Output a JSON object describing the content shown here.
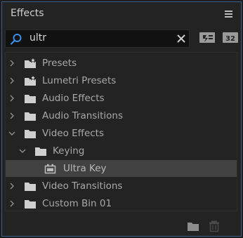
{
  "panel": {
    "title": "Effects"
  },
  "search": {
    "value": "ultr"
  },
  "tree": {
    "items": [
      {
        "label": "Presets",
        "expanded": false,
        "icon": "preset-folder-icon"
      },
      {
        "label": "Lumetri Presets",
        "expanded": false,
        "icon": "preset-folder-icon"
      },
      {
        "label": "Audio Effects",
        "expanded": false,
        "icon": "folder-icon"
      },
      {
        "label": "Audio Transitions",
        "expanded": false,
        "icon": "folder-icon"
      },
      {
        "label": "Video Effects",
        "expanded": true,
        "icon": "folder-icon"
      },
      {
        "label": "Keying",
        "expanded": true,
        "icon": "folder-icon"
      },
      {
        "label": "Ultra Key",
        "selected": true,
        "icon": "effect-icon"
      },
      {
        "label": "Video Transitions",
        "expanded": false,
        "icon": "folder-icon"
      },
      {
        "label": "Custom Bin 01",
        "expanded": false,
        "icon": "folder-icon"
      }
    ]
  },
  "toolbar": {
    "button_b_label": "32"
  },
  "colors": {
    "accent_border": "#3a5f8f",
    "search_icon": "#3d8ee8",
    "selected_row": "#414141"
  }
}
